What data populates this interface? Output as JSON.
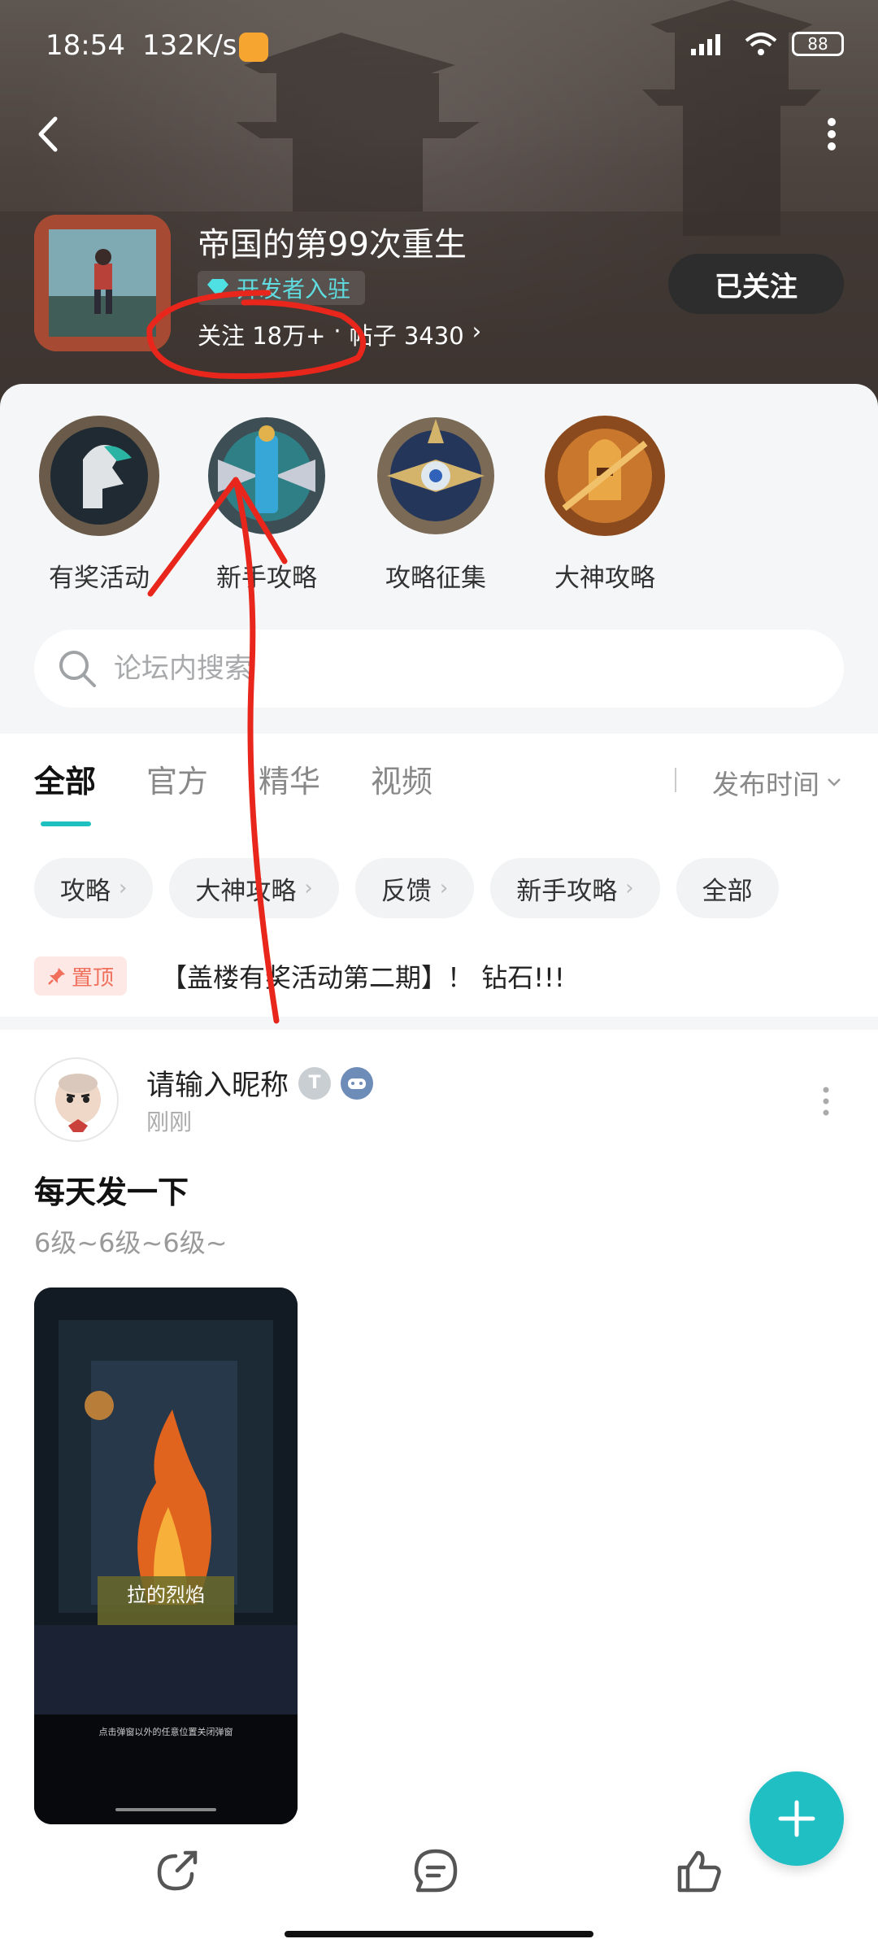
{
  "status_bar": {
    "time": "18:54",
    "speed": "132K/s",
    "battery": "88"
  },
  "forum": {
    "title": "帝国的第99次重生",
    "dev_badge": "开发者入驻",
    "followers": "关注 18万+",
    "separator": "·",
    "posts": "帖子 3430",
    "follow_button": "已关注"
  },
  "quick_links": [
    {
      "label": "有奖活动"
    },
    {
      "label": "新手攻略"
    },
    {
      "label": "攻略征集"
    },
    {
      "label": "大神攻略"
    }
  ],
  "search": {
    "placeholder": "论坛内搜索"
  },
  "tabs": [
    {
      "label": "全部",
      "active": true
    },
    {
      "label": "官方"
    },
    {
      "label": "精华"
    },
    {
      "label": "视频"
    }
  ],
  "sort": {
    "label": "发布时间"
  },
  "chips": [
    {
      "label": "攻略"
    },
    {
      "label": "大神攻略"
    },
    {
      "label": "反馈"
    },
    {
      "label": "新手攻略"
    },
    {
      "label": "全部"
    }
  ],
  "pinned": {
    "badge": "置顶",
    "text": "【盖楼有奖活动第二期】！ 钻石!!!"
  },
  "post": {
    "nickname": "请输入昵称",
    "level_badge": "T",
    "time": "刚刚",
    "title": "每天发一下",
    "body": "6级~6级~6级~",
    "image_caption": "拉的烈焰",
    "image_hint": "点击弹窗以外的任意位置关闭弹窗"
  },
  "colors": {
    "accent": "#1fc1c0",
    "pin": "#f0705c",
    "annotation": "#e8261c"
  }
}
